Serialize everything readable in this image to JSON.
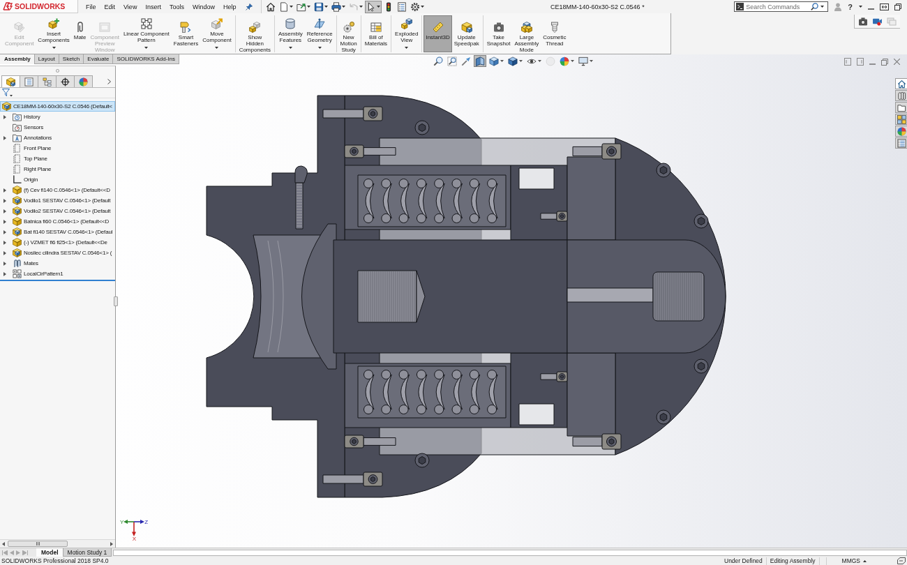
{
  "title_bar": {
    "logo": "**SOLID**WORKS",
    "menus": [
      "File",
      "Edit",
      "View",
      "Insert",
      "Tools",
      "Window",
      "Help"
    ],
    "quick_access": [
      {
        "dropdown": false,
        "disabled": false,
        "selected": false
      },
      {
        "dropdown": true,
        "disabled": false,
        "selected": false
      },
      {
        "dropdown": true,
        "disabled": false,
        "selected": false
      },
      {
        "dropdown": true,
        "disabled": false,
        "selected": false
      },
      {
        "dropdown": true,
        "disabled": false,
        "selected": false
      },
      {
        "dropdown": true,
        "disabled": true,
        "selected": false
      },
      {
        "dropdown": true,
        "disabled": false,
        "selected": true
      },
      {
        "dropdown": false,
        "disabled": false,
        "selected": false
      },
      {
        "dropdown": false,
        "disabled": false,
        "selected": false
      },
      {
        "dropdown": true,
        "disabled": false,
        "selected": false
      }
    ],
    "document_title": "CE18MM-140-60x30-S2 C.0546 *",
    "search": {
      "placeholder": "Search Commands"
    },
    "help": "?"
  },
  "command_manager": {
    "groups": [
      [
        {
          "label": "Edit\nComponent",
          "disabled": true,
          "dropdown": false,
          "selected": false
        },
        {
          "label": "Insert\nComponents",
          "disabled": false,
          "dropdown": true,
          "selected": false
        },
        {
          "label": "Mate",
          "disabled": false,
          "dropdown": false,
          "selected": false
        },
        {
          "label": "Component\nPreview\nWindow",
          "disabled": true,
          "dropdown": false,
          "selected": false
        },
        {
          "label": "Linear Component\nPattern",
          "disabled": false,
          "dropdown": true,
          "selected": false
        },
        {
          "label": "Smart\nFasteners",
          "disabled": false,
          "dropdown": false,
          "selected": false
        },
        {
          "label": "Move\nComponent",
          "disabled": false,
          "dropdown": true,
          "selected": false
        }
      ],
      [
        {
          "label": "Show\nHidden\nComponents",
          "disabled": false,
          "dropdown": false,
          "selected": false
        }
      ],
      [
        {
          "label": "Assembly\nFeatures",
          "disabled": false,
          "dropdown": true,
          "selected": false
        },
        {
          "label": "Reference\nGeometry",
          "disabled": false,
          "dropdown": true,
          "selected": false
        }
      ],
      [
        {
          "label": "New\nMotion\nStudy",
          "disabled": false,
          "dropdown": false,
          "selected": false
        }
      ],
      [
        {
          "label": "Bill of\nMaterials",
          "disabled": false,
          "dropdown": false,
          "selected": false
        }
      ],
      [
        {
          "label": "Exploded\nView",
          "disabled": false,
          "dropdown": true,
          "selected": false
        }
      ],
      [
        {
          "label": "Instant3D",
          "disabled": false,
          "dropdown": false,
          "selected": true
        },
        {
          "label": "Update\nSpeedpak",
          "disabled": false,
          "dropdown": false,
          "selected": false
        }
      ],
      [
        {
          "label": "Take\nSnapshot",
          "disabled": false,
          "dropdown": false,
          "selected": false
        },
        {
          "label": "Large\nAssembly\nMode",
          "disabled": false,
          "dropdown": false,
          "selected": false
        },
        {
          "label": "Cosmetic\nThread",
          "disabled": false,
          "dropdown": false,
          "selected": false
        }
      ]
    ],
    "tabs": [
      {
        "label": "Assembly",
        "selected": true
      },
      {
        "label": "Layout",
        "selected": false
      },
      {
        "label": "Sketch",
        "selected": false
      },
      {
        "label": "Evaluate",
        "selected": false
      },
      {
        "label": "SOLIDWORKS Add-Ins",
        "selected": false
      }
    ]
  },
  "view_toolbar": [
    {
      "dropdown": false,
      "disabled": false,
      "selected": false
    },
    {
      "dropdown": false,
      "disabled": false,
      "selected": false
    },
    {
      "dropdown": false,
      "disabled": false,
      "selected": false
    },
    {
      "dropdown": false,
      "disabled": false,
      "selected": true
    },
    {
      "dropdown": true,
      "disabled": false,
      "selected": false
    },
    {
      "dropdown": true,
      "disabled": false,
      "selected": false
    },
    {
      "dropdown": true,
      "disabled": false,
      "selected": false
    },
    {
      "dropdown": false,
      "disabled": true,
      "selected": false
    },
    {
      "dropdown": true,
      "disabled": false,
      "selected": false
    },
    {
      "dropdown": true,
      "disabled": false,
      "selected": false
    }
  ],
  "feature_tree": {
    "panel_tabs": [
      {
        "selected": true
      },
      {
        "selected": false
      },
      {
        "selected": false
      },
      {
        "selected": false
      },
      {
        "selected": false
      }
    ],
    "root": {
      "label": "CE18MM-140-60x30-S2 C.0546 (Default<",
      "kind": "assembly",
      "selected": true,
      "children": [
        {
          "label": "History",
          "kind": "history",
          "expandable": true,
          "selected": false
        },
        {
          "label": "Sensors",
          "kind": "sensors",
          "expandable": false,
          "selected": false
        },
        {
          "label": "Annotations",
          "kind": "annotations",
          "expandable": true,
          "selected": false
        },
        {
          "label": "Front Plane",
          "kind": "plane",
          "expandable": false,
          "selected": false
        },
        {
          "label": "Top Plane",
          "kind": "plane",
          "expandable": false,
          "selected": false
        },
        {
          "label": "Right Plane",
          "kind": "plane",
          "expandable": false,
          "selected": false
        },
        {
          "label": "Origin",
          "kind": "origin",
          "expandable": false,
          "selected": false
        },
        {
          "label": "(f) Cev fi140 C.0546<1> (Default<<D",
          "kind": "part",
          "expandable": true,
          "selected": false
        },
        {
          "label": "Vodilo1 SESTAV C.0546<1> (Default",
          "kind": "assembly",
          "expandable": true,
          "selected": false
        },
        {
          "label": "Vodilo2 SESTAV C.0546<1> (Default",
          "kind": "assembly",
          "expandable": true,
          "selected": false
        },
        {
          "label": "Batnica fi60 C.0546<1> (Default<<D",
          "kind": "part",
          "expandable": true,
          "selected": false
        },
        {
          "label": "Bat fi140 SESTAV C.0546<1> (Defaul",
          "kind": "assembly",
          "expandable": true,
          "selected": false
        },
        {
          "label": "(-) VZMET fi6 fi25<1> (Default<<De",
          "kind": "part",
          "expandable": true,
          "selected": false
        },
        {
          "label": "Nosilec cilindra SESTAV C.0546<1> (",
          "kind": "assembly",
          "expandable": true,
          "selected": false
        },
        {
          "label": "Mates",
          "kind": "mates",
          "expandable": true,
          "selected": false
        },
        {
          "label": "LocalCirPattern1",
          "kind": "pattern",
          "expandable": true,
          "selected": false
        }
      ]
    }
  },
  "task_pane": [
    {
      "selected": true
    },
    {
      "selected": false
    },
    {
      "selected": false
    },
    {
      "selected": false
    },
    {
      "selected": false
    },
    {
      "selected": false
    }
  ],
  "triad": {
    "axes": [
      "Y",
      "Z",
      "X"
    ]
  },
  "bottom_tabs": [
    {
      "label": "Model",
      "selected": true
    },
    {
      "label": "Motion Study 1",
      "selected": false
    }
  ],
  "status_bar": {
    "product": "SOLIDWORKS Professional 2018 SP4.0",
    "state": "Under Defined",
    "mode": "Editing Assembly",
    "units": "MMGS"
  }
}
